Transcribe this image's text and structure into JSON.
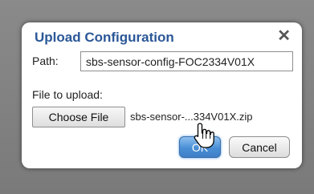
{
  "dialog": {
    "title": "Upload Configuration",
    "close_glyph": "✕",
    "path_label": "Path:",
    "path_value": "sbs-sensor-config-FOC2334V01X",
    "file_label": "File to upload:",
    "choose_label": "Choose File",
    "file_name": "sbs-sensor-...334V01X.zip",
    "ok_label": "OK",
    "cancel_label": "Cancel"
  },
  "icons": {
    "close": "close-icon",
    "cursor": "hand-pointer-icon"
  },
  "colors": {
    "title": "#2b5797",
    "ok_button": "#4a8fd6",
    "backdrop": "#7f7f7f"
  }
}
